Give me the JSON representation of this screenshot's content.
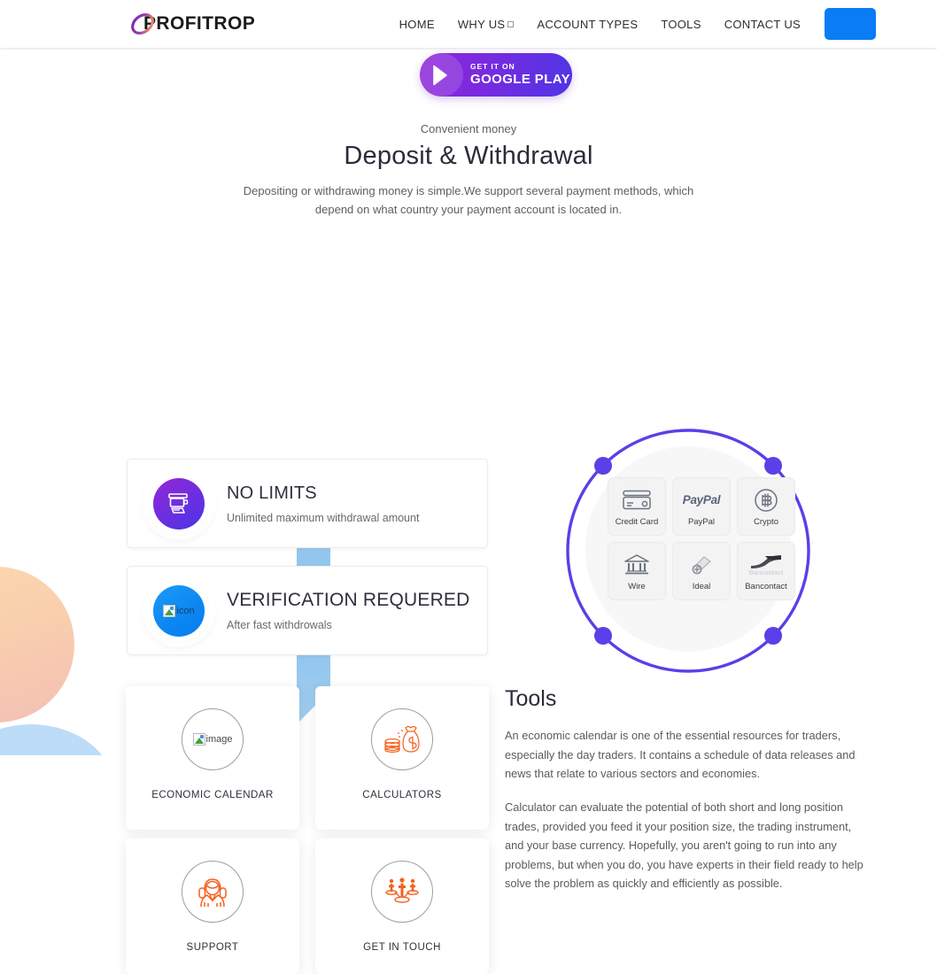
{
  "header": {
    "brand": "PROFITROP",
    "nav": [
      {
        "label": "HOME",
        "has_caret": false
      },
      {
        "label": "WHY US",
        "has_caret": true
      },
      {
        "label": "ACCOUNT TYPES",
        "has_caret": false
      },
      {
        "label": "TOOLS",
        "has_caret": false
      },
      {
        "label": "CONTACT US",
        "has_caret": false
      }
    ],
    "cta_label": "",
    "cta_color": "#0a7cf5"
  },
  "google_play": {
    "small_text": "GET IT ON",
    "big_text": "GOOGLE PLAY",
    "gradient_from": "#9126d8",
    "gradient_to": "#4f35e6"
  },
  "hero": {
    "eyebrow": "Convenient money",
    "title": "Deposit & Withdrawal",
    "description": "Depositing or withdrawing money is simple.We support several payment methods, which depend on what country your payment account is located in."
  },
  "features": [
    {
      "title": "NO LIMITS",
      "subtitle": "Unlimited maximum withdrawal amount",
      "icon": "atm-withdrawal-icon",
      "icon_style": "purple-gradient",
      "icon_broken": false
    },
    {
      "title": "VERIFICATION REQUERED",
      "subtitle": "After fast withdrowals",
      "icon": "broken-image-icon",
      "icon_style": "blue-gradient",
      "icon_broken": true,
      "icon_alt_text": "icon"
    }
  ],
  "payment_wheel": {
    "ring_color": "#5b3fe8",
    "disc_color": "#f7f7f8",
    "methods": [
      {
        "name": "Credit Card",
        "icon": "credit-card-icon"
      },
      {
        "name": "PayPal",
        "icon": "paypal-logo",
        "wordmark": "PayPal"
      },
      {
        "name": "Crypto",
        "icon": "bitcoin-icon"
      },
      {
        "name": "Wire",
        "icon": "bank-icon"
      },
      {
        "name": "Ideal",
        "icon": "ideal-logo"
      },
      {
        "name": "Bancontact",
        "icon": "bancontact-logo",
        "wordmark": "Bancontact"
      }
    ]
  },
  "tools": {
    "title": "Tools",
    "paragraphs": [
      "An economic calendar is one of the essential resources for traders, especially the day traders. It contains a schedule of data releases and news that relate to various sectors and economies.",
      "Calculator can evaluate the potential of both short and long position trades, provided you feed it your position size, the trading instrument, and your base currency. Hopefully, you aren't going to run into any problems, but when you do, you have experts in their field ready to help solve the problem as quickly and efficiently as possible."
    ]
  },
  "tool_cards": [
    {
      "label": "ECONOMIC CALENDAR",
      "icon": "broken-image-icon",
      "icon_broken": true,
      "icon_alt_text": "image"
    },
    {
      "label": "CALCULATORS",
      "icon": "money-bag-coins-icon",
      "icon_broken": false
    },
    {
      "label": "SUPPORT",
      "icon": "support-agent-icon",
      "icon_broken": false
    },
    {
      "label": "GET IN TOUCH",
      "icon": "team-people-icon",
      "icon_broken": false
    }
  ],
  "theme": {
    "accent_orange": "#f4601e",
    "accent_purple": "#5b3fe8",
    "accent_blue": "#0a7cf5",
    "blob_orange": "#f9cfae",
    "blob_blue": "#bcdcf7",
    "ribbon_blue": "#8cc2ec"
  }
}
